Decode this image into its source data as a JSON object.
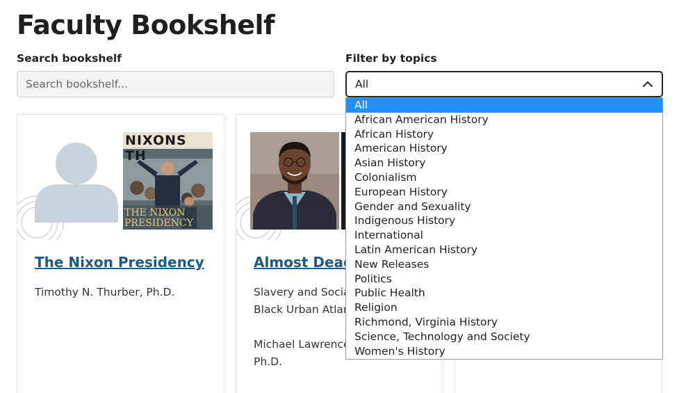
{
  "page": {
    "title": "Faculty Bookshelf"
  },
  "search": {
    "label": "Search bookshelf",
    "placeholder": "Search bookshelf..."
  },
  "filter": {
    "label": "Filter by topics",
    "selected": "All",
    "options": [
      "All",
      "African American History",
      "African History",
      "American History",
      "Asian History",
      "Colonialism",
      "European History",
      "Gender and Sexuality",
      "Indigenous History",
      "International",
      "Latin American History",
      "New Releases",
      "Politics",
      "Public Health",
      "Religion",
      "Richmond, Virginia History",
      "Science, Technology and Society",
      "Women's History"
    ]
  },
  "cards": [
    {
      "title": "The Nixon Presidency",
      "author": "Timothy N. Thurber, Ph.D.",
      "cover_text_line1": "NIXONS TH",
      "cover_text_line2": "THE NIXON",
      "cover_text_line3": "PRESIDENCY"
    },
    {
      "title": "Almost Dead",
      "subtitle_line1": "Slavery and Social",
      "subtitle_line2": "Black Urban Atlant",
      "author_line1": "Michael Lawrence",
      "author_line2": "Ph.D."
    }
  ],
  "colors": {
    "link": "#1d5a86",
    "selected_option_bg": "#1e90ff",
    "avatar_placeholder": "#c9d3dc"
  }
}
